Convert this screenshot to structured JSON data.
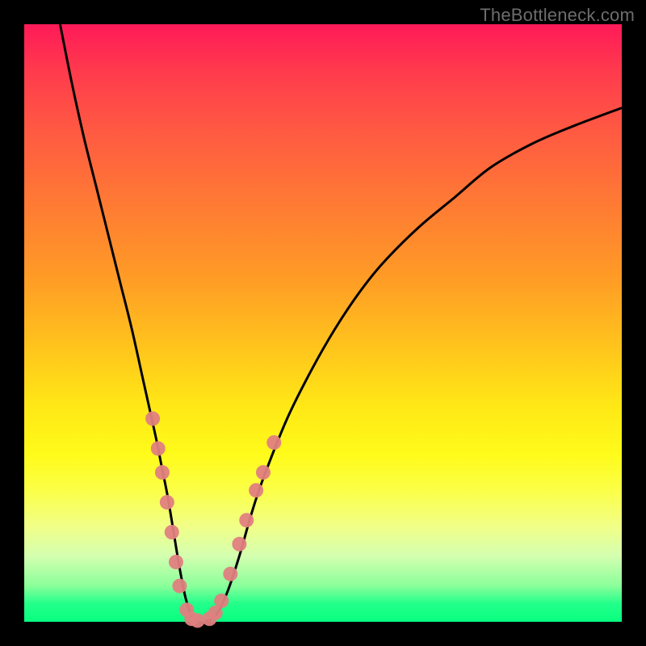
{
  "watermark": "TheBottleneck.com",
  "colors": {
    "frame_bg_top": "#ff1a58",
    "frame_bg_bottom": "#08ff80",
    "curve": "#000000",
    "marker": "#e08080",
    "page_bg": "#000000",
    "watermark": "#6d6d6d"
  },
  "chart_data": {
    "type": "line",
    "title": "",
    "xlabel": "",
    "ylabel": "",
    "x_range": [
      0,
      100
    ],
    "y_range": [
      0,
      100
    ],
    "grid": false,
    "legend": false,
    "series": [
      {
        "name": "curve",
        "x": [
          6,
          8,
          10,
          12,
          14,
          16,
          18,
          20,
          22,
          23,
          24,
          25,
          26,
          27,
          28,
          29,
          30,
          32,
          34,
          36,
          38,
          40,
          44,
          48,
          52,
          56,
          60,
          66,
          72,
          78,
          85,
          92,
          100
        ],
        "y": [
          100,
          90,
          81,
          73,
          65,
          57,
          49,
          40,
          31,
          26,
          21,
          15,
          9,
          4,
          1,
          0,
          0,
          1,
          5,
          11,
          18,
          24,
          34,
          42,
          49,
          55,
          60,
          66,
          71,
          76,
          80,
          83,
          86
        ]
      }
    ],
    "markers": {
      "left_cluster": [
        {
          "x": 21.5,
          "y": 34
        },
        {
          "x": 22.4,
          "y": 29
        },
        {
          "x": 23.1,
          "y": 25
        },
        {
          "x": 23.9,
          "y": 20
        },
        {
          "x": 24.7,
          "y": 15
        },
        {
          "x": 25.4,
          "y": 10
        },
        {
          "x": 26.0,
          "y": 6
        },
        {
          "x": 27.2,
          "y": 2
        },
        {
          "x": 28.0,
          "y": 0.5
        },
        {
          "x": 29.0,
          "y": 0.2
        }
      ],
      "right_cluster": [
        {
          "x": 31.0,
          "y": 0.5
        },
        {
          "x": 32.0,
          "y": 1.5
        },
        {
          "x": 33.0,
          "y": 3.5
        },
        {
          "x": 34.5,
          "y": 8
        },
        {
          "x": 36.0,
          "y": 13
        },
        {
          "x": 37.2,
          "y": 17
        },
        {
          "x": 38.8,
          "y": 22
        },
        {
          "x": 40.0,
          "y": 25
        },
        {
          "x": 41.8,
          "y": 30
        }
      ]
    }
  }
}
